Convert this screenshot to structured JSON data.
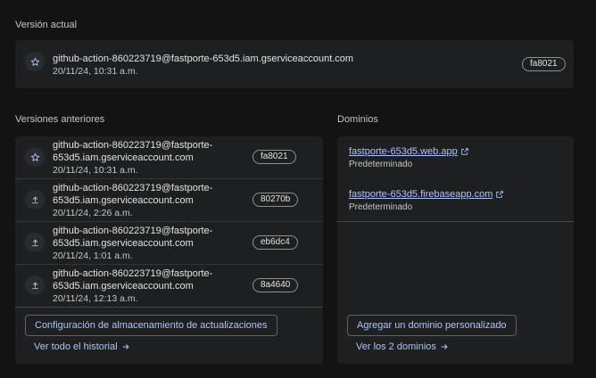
{
  "current_version": {
    "title": "Versión actual",
    "entry": {
      "author": "github-action-860223719@fastporte-653d5.iam.gserviceaccount.com",
      "date": "20/11/24, 10:31 a.m.",
      "hash": "fa8021",
      "icon": "star-icon"
    }
  },
  "previous_versions": {
    "title": "Versiones anteriores",
    "entries": [
      {
        "author_line1": "github-action-860223719@fastporte-",
        "author_line2": "653d5.iam.gserviceaccount.com",
        "date": "20/11/24, 10:31 a.m.",
        "hash": "fa8021",
        "icon": "star-icon"
      },
      {
        "author_line1": "github-action-860223719@fastporte-",
        "author_line2": "653d5.iam.gserviceaccount.com",
        "date": "20/11/24, 2:26 a.m.",
        "hash": "80270b",
        "icon": "upload-icon"
      },
      {
        "author_line1": "github-action-860223719@fastporte-",
        "author_line2": "653d5.iam.gserviceaccount.com",
        "date": "20/11/24, 1:01 a.m.",
        "hash": "eb6dc4",
        "icon": "upload-icon"
      },
      {
        "author_line1": "github-action-860223719@fastporte-",
        "author_line2": "653d5.iam.gserviceaccount.com",
        "date": "20/11/24, 12:13 a.m.",
        "hash": "8a4640",
        "icon": "upload-icon"
      }
    ],
    "config_button": "Configuración de almacenamiento de actualizaciones",
    "history_link": "Ver todo el historial"
  },
  "domains": {
    "title": "Dominios",
    "items": [
      {
        "name": "fastporte-653d5.web.app",
        "label": "Predeterminado"
      },
      {
        "name": "fastporte-653d5.firebaseapp.com",
        "label": "Predeterminado"
      }
    ],
    "add_button": "Agregar un dominio personalizado",
    "view_link": "Ver los 2 dominios"
  },
  "colors": {
    "background": "#131314",
    "card": "#1e1f20",
    "accent": "#a8c7fa",
    "text": "#e3e3e3"
  }
}
